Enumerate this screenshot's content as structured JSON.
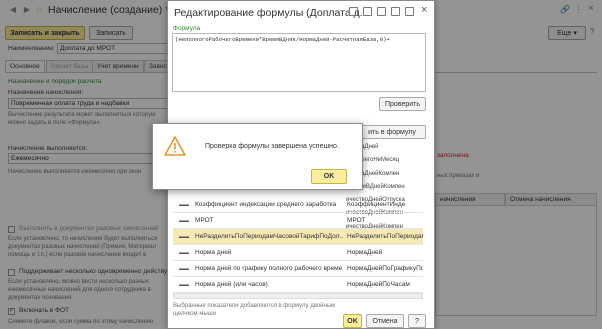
{
  "main_window": {
    "title": "Начисление (создание) *",
    "post_close_label": "Записать и закрыть",
    "write_label": "Записать",
    "more_label": "Еще",
    "name_label": "Наименование:",
    "name_value": "Доплата до МРОТ",
    "tabs": [
      "Основное",
      "Расчет базы",
      "Учет времени",
      "Завис"
    ],
    "section_title": "Назначение и порядок расчета",
    "purpose_label": "Назначение начисления:",
    "purpose_value": "Повременная оплата труда и надбавки",
    "purpose_note": "Вычисление результата может выполняться которую можно задать в поле «Формула».",
    "performed_label": "Начисление выполняется:",
    "performed_value": "Ежемесячно",
    "performed_note": "Начисление выполняется ежемесячно при окон",
    "one_time_label": "Выполнять в документах разовых начислений",
    "one_time_note": "Если установлено, то начисление будет выполняться документах разовых начислений (Премия, Материал помощь и т.п.) если разовое начисление входит в",
    "multi_label": "Поддерживает несколько одновременно действу",
    "multi_note": "Если установлено, можно вести несколько разных ежемесячных начислений для одного сотрудника в документах основания",
    "fot_label": "Включать в ФОТ",
    "fot_note": "Снимите флажок, если сумма по этому начислению",
    "right_red": "заполнена",
    "right_note1": "ных приказах и",
    "col_start": "начисления",
    "col_cancel": "Отмена начисления"
  },
  "formula_dialog": {
    "title": "Редактирование формулы (Доплата д...",
    "formula_label": "Формула",
    "formula_text": "(НеполногоРабочегоВремени*ВремяВДняк/НормаДней-РасчетнаяБаза,0)+",
    "check_label": "Проверить",
    "insert_label": "ить в формулу",
    "side_items": [
      "НормаДней",
      "БольшегоНеМесяц",
      "НормаДнейКомпен",
      "иместиВДнейКомпен",
      "ичествоДнейОтпуска",
      "ичествоДнейКомпен",
      "ичествоДнейКомпен"
    ],
    "rows": [
      {
        "name": "Коэффициент индексации среднего заработка",
        "id": "КоэффициентИнде"
      },
      {
        "name": "МРОТ",
        "id": "МРОТ"
      },
      {
        "name": "НеРазделитьПоПериодамЧасовойТарифПоДол...",
        "id": "НеРазделитьПоПериодам"
      },
      {
        "name": "Норма дней",
        "id": "НормаДней"
      },
      {
        "name": "Норма дней по графику полного рабочего време...",
        "id": "НормаДнейПоГрафикуПо"
      },
      {
        "name": "Норма дней (или часов)",
        "id": "НормаДнейПоЧасам"
      }
    ],
    "hint": "Выбранные показатели добавляются в формулу двойным щелчком мыши",
    "ok_label": "OK",
    "cancel_label": "Отмена"
  },
  "alert": {
    "message": "Проверка формулы завершена успешно.",
    "ok_label": "OK"
  },
  "colors": {
    "accent_yellow": "#fbed9e",
    "selected_row": "#f5e9b6",
    "green_text": "#3a8a3a",
    "red_text": "#c92c2c",
    "warning_orange": "#e8962e"
  }
}
